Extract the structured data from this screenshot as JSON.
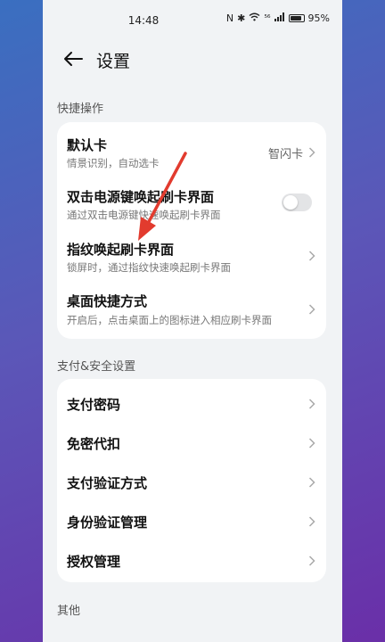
{
  "status_bar": {
    "time": "14:48",
    "battery": "95%",
    "signal_text": "⁵⁶"
  },
  "header": {
    "title": "设置"
  },
  "sections": {
    "quick": {
      "label": "快捷操作",
      "items": [
        {
          "title": "默认卡",
          "subtitle": "情景识别，自动选卡",
          "value": "智闪卡"
        },
        {
          "title": "双击电源键唤起刷卡界面",
          "subtitle": "通过双击电源键快速唤起刷卡界面",
          "toggle_on": false
        },
        {
          "title": "指纹唤起刷卡界面",
          "subtitle": "锁屏时，通过指纹快速唤起刷卡界面"
        },
        {
          "title": "桌面快捷方式",
          "subtitle": "开启后，点击桌面上的图标进入相应刷卡界面"
        }
      ]
    },
    "payment": {
      "label": "支付&安全设置",
      "items": [
        {
          "title": "支付密码"
        },
        {
          "title": "免密代扣"
        },
        {
          "title": "支付验证方式"
        },
        {
          "title": "身份验证管理"
        },
        {
          "title": "授权管理"
        }
      ]
    },
    "other": {
      "label": "其他"
    }
  },
  "colors": {
    "annotation_arrow": "#e23b2e",
    "card_bg": "#ffffff",
    "page_bg": "#f1f3f5"
  }
}
